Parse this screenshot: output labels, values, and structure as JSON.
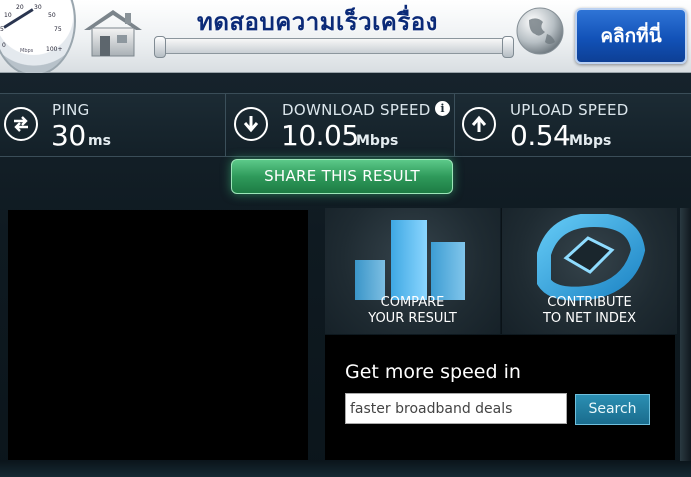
{
  "banner": {
    "title": "ทดสอบความเร็วเครื่อง",
    "click_button": "คลิกที่นี่",
    "gauge_ticks": [
      "0",
      "5",
      "10",
      "20",
      "30",
      "50",
      "75",
      "100+"
    ],
    "gauge_unit": "Mbps"
  },
  "stats": {
    "ping": {
      "label": "PING",
      "value": "30",
      "unit": "ms",
      "icon": "transfer-arrows-icon"
    },
    "download": {
      "label": "DOWNLOAD SPEED",
      "value": "10.05",
      "unit": "Mbps",
      "icon": "download-arrow-icon"
    },
    "upload": {
      "label": "UPLOAD SPEED",
      "value": "0.54",
      "unit": "Mbps",
      "icon": "upload-arrow-icon"
    }
  },
  "share_button": "SHARE THIS RESULT",
  "tiles": {
    "compare": {
      "line1": "COMPARE",
      "line2": "YOUR RESULT"
    },
    "contribute": {
      "line1": "CONTRIBUTE",
      "line2": "TO NET INDEX"
    }
  },
  "ad": {
    "title": "Get more speed in",
    "input_value": "faster broadband deals",
    "search_label": "Search"
  },
  "colors": {
    "accent_green": "#2f9a5b",
    "banner_title": "#0b2a78",
    "button_blue": "#1252b8"
  }
}
